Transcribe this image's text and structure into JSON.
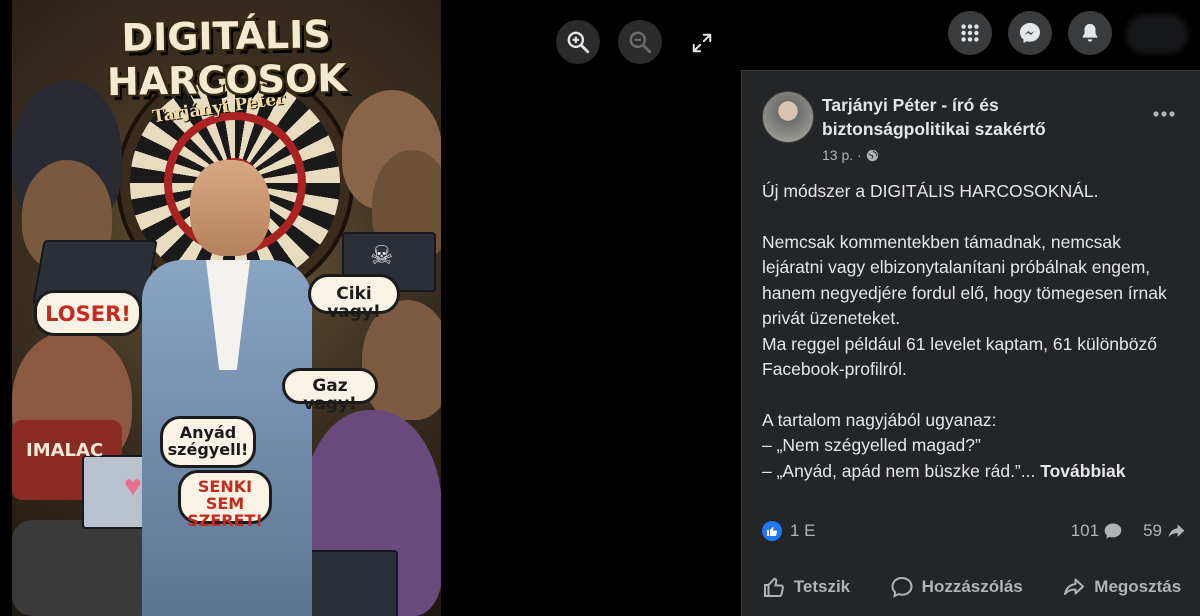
{
  "poster": {
    "title": "DIGITÁLIS HARCOSOK",
    "dartboard_name": "Tarjányi Péter",
    "bubbles": {
      "loser": "LOSER!",
      "ciki": "Ciki vagy!",
      "gaz": "Gaz vagy!",
      "anyad": "Anyád szégyell!",
      "senki": "SENKI SEM SZERET!"
    },
    "shirt_text": "IMALAC"
  },
  "viewer": {
    "zoom_in_icon": "zoom-in-icon",
    "zoom_out_icon": "zoom-out-icon",
    "fullscreen_icon": "expand-icon"
  },
  "topnav": {
    "menu_icon": "grid-menu-icon",
    "messenger_icon": "messenger-icon",
    "notifications_icon": "bell-icon"
  },
  "post": {
    "author": "Tarjányi Péter - író és biztonságpolitikai szakértő",
    "time": "13 p.",
    "privacy_icon": "globe-icon",
    "paragraphs": [
      "Új módszer a DIGITÁLIS HARCOSOKNÁL.",
      "Nemcsak kommentekben támadnak, nemcsak lejáratni vagy elbizonytalanítani próbálnak engem, hanem negyedjére fordul elő, hogy tömegesen írnak privát üzeneteket.\nMa reggel például 61 levelet kaptam, 61 különböző Facebook-profilról.",
      "A tartalom nagyjából ugyanaz:\n– „Nem szégyelled magad?”"
    ],
    "last_line": "– „Anyád, apád nem büszke rád.”...",
    "see_more": "Továbbiak",
    "reaction_count": "1 E",
    "comment_count": "101",
    "share_count": "59",
    "actions": {
      "like": "Tetszik",
      "comment": "Hozzászólás",
      "share": "Megosztás"
    }
  },
  "colors": {
    "panel_bg": "#242526",
    "text_primary": "#e4e6eb",
    "text_secondary": "#b0b3b8",
    "like_blue": "#2078f4"
  }
}
